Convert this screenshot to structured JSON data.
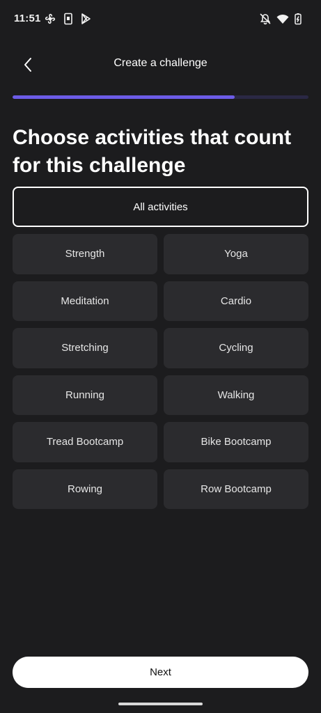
{
  "status_bar": {
    "time": "11:51",
    "icons": [
      "fan-icon",
      "phone-notification-icon",
      "play-store-icon",
      "bell-off-icon",
      "wifi-icon",
      "battery-charging-icon"
    ]
  },
  "header": {
    "title": "Create a challenge",
    "back_icon": "chevron-left-icon"
  },
  "progress": {
    "fraction": 0.75,
    "fill_color": "#6c5ce7",
    "track_color": "#2a2844"
  },
  "heading": "Choose activities that count for this challenge",
  "all_activities_label": "All activities",
  "activities": [
    "Strength",
    "Yoga",
    "Meditation",
    "Cardio",
    "Stretching",
    "Cycling",
    "Running",
    "Walking",
    "Tread Bootcamp",
    "Bike Bootcamp",
    "Rowing",
    "Row Bootcamp"
  ],
  "footer": {
    "next_label": "Next"
  }
}
